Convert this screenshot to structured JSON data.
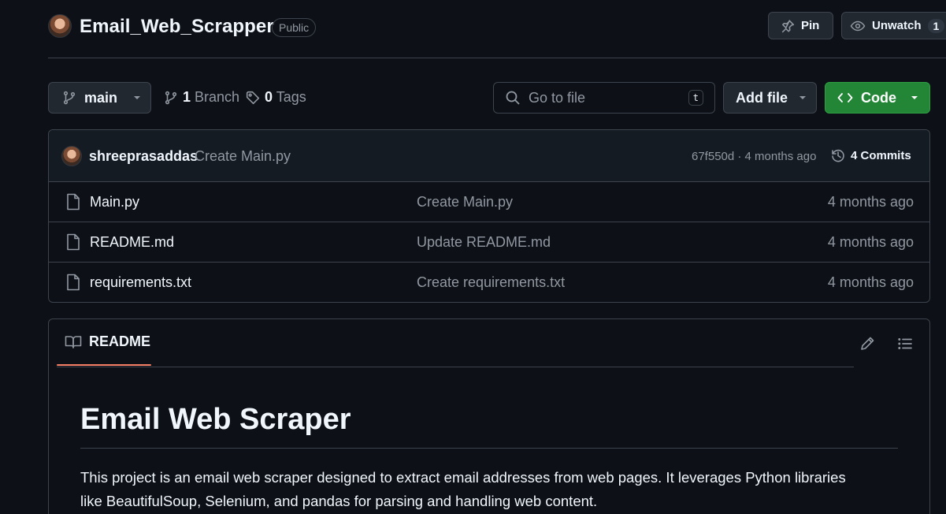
{
  "header": {
    "repo_name": "Email_Web_Scrapper",
    "visibility": "Public",
    "pin_label": "Pin",
    "unwatch_label": "Unwatch",
    "watch_count": "1"
  },
  "toolbar": {
    "branch_name": "main",
    "branch_count": "1",
    "branch_label": "Branch",
    "tag_count": "0",
    "tag_label": "Tags",
    "search_placeholder": "Go to file",
    "search_shortcut": "t",
    "add_file_label": "Add file",
    "code_label": "Code"
  },
  "latest_commit": {
    "author": "shreeprasaddas",
    "message": "Create Main.py",
    "hash_age": "67f550d · 4 months ago",
    "commits_count": "4",
    "commits_label": "Commits"
  },
  "files": [
    {
      "name": "Main.py",
      "message": "Create Main.py",
      "age": "4 months ago"
    },
    {
      "name": "README.md",
      "message": "Update README.md",
      "age": "4 months ago"
    },
    {
      "name": "requirements.txt",
      "message": "Create requirements.txt",
      "age": "4 months ago"
    }
  ],
  "readme": {
    "tab_label": "README",
    "heading": "Email Web Scraper",
    "paragraph_line1": "This project is an email web scraper designed to extract email addresses from web pages. It leverages Python libraries",
    "paragraph_line2": "like BeautifulSoup, Selenium, and pandas for parsing and handling web content."
  },
  "colors": {
    "background": "#0d1117",
    "accent_green": "#238636",
    "tab_underline": "#f78166",
    "border": "#3d444d",
    "muted_text": "#9198a1"
  },
  "icons": [
    "repo-owner-avatar",
    "pin-icon",
    "eye-icon",
    "branch-icon",
    "tag-icon",
    "search-icon",
    "code-icon",
    "chevron-down-icon",
    "history-icon",
    "file-icon",
    "book-icon",
    "pencil-icon",
    "list-icon"
  ]
}
